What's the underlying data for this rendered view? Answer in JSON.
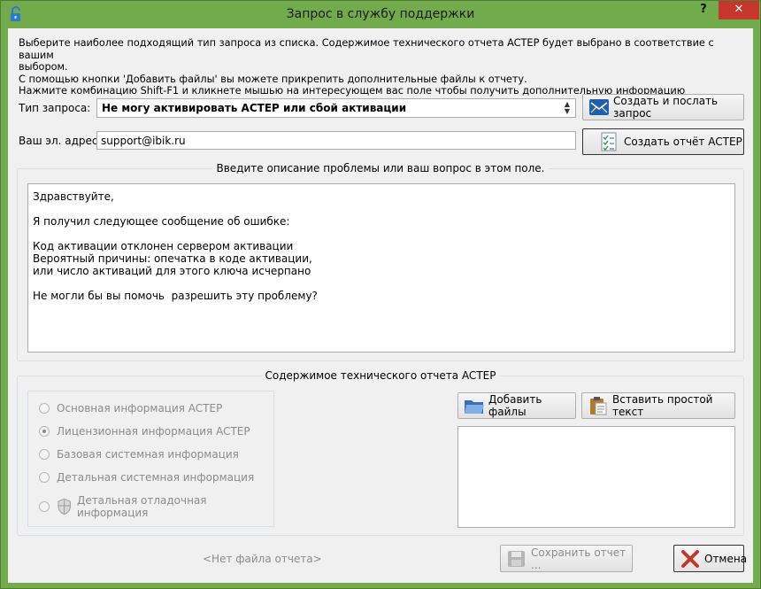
{
  "window": {
    "title": "Запрос в службу поддержки",
    "help": "?",
    "close": "✕"
  },
  "info": {
    "line1": "Выберите наиболее подходящий тип запроса из списка. Содержимое технического отчета ACTEP будет выбрано в соответствие с вашим",
    "line2": "выбором.",
    "line3": "С помощью кнопки 'Добавить файлы' вы можете прикрепить дополнительные файлы к отчету.",
    "line4": "Нажмите комбинацию Shift-F1 и кликнете мышью на интересующем вас поле чтобы получить дополнительную информацию"
  },
  "form": {
    "request_type_label": "Тип запроса:",
    "request_type_value": "Не могу активировать ACTEP или сбой активации",
    "email_label": "Ваш эл. адрес:",
    "email_value": "support@ibik.ru"
  },
  "buttons": {
    "create_send": "Создать и послать запрос",
    "create_report": "Создать отчёт ACTEP",
    "add_files": "Добавить файлы",
    "paste_text": "Вставить простой текст",
    "save_report": "Сохранить отчет ...",
    "cancel": "Отмена"
  },
  "description": {
    "title": "Введите описание проблемы или ваш вопрос в этом поле.",
    "text": "Здравствуйте,\n\nЯ получил следующее сообщение об ошибке:\n\nКод активации отклонен сервером активации\nВероятный причины: опечатка в коде активации,\nили число активаций для этого ключа исчерпано\n\nНе могли бы вы помочь  разрешить эту проблему?"
  },
  "report": {
    "title": "Содержимое технического отчета ACTEP",
    "options": [
      {
        "label": "Основная информация ACTEP",
        "checked": false
      },
      {
        "label": "Лицензионная информация ACTEP",
        "checked": true
      },
      {
        "label": "Базовая системная информация",
        "checked": false
      },
      {
        "label": "Детальная системная информация",
        "checked": false
      },
      {
        "label": "Детальная отладочная информация",
        "checked": false
      }
    ],
    "no_file": "<Нет файла отчета>"
  },
  "colors": {
    "frame": "#72ab4c",
    "close_button": "#c7362c",
    "client_bg": "#f0f0f0"
  },
  "icons": {
    "app": "open-lock-icon",
    "create_send": "envelope-icon",
    "create_report": "checklist-icon",
    "add_files": "folder-icon",
    "paste_text": "clipboard-icon",
    "save_report": "floppy-disk-icon",
    "cancel": "red-x-icon",
    "debug_option": "shield-icon"
  }
}
